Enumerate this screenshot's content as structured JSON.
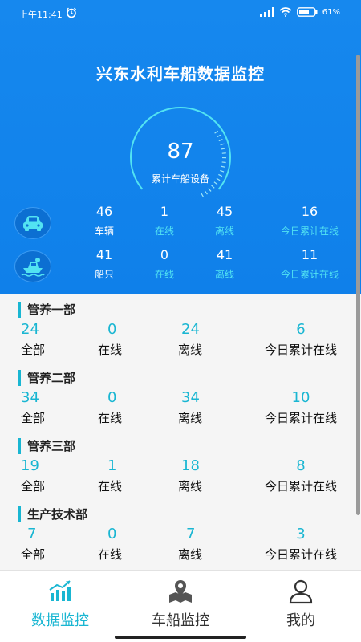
{
  "status_bar": {
    "time": "上午11:41",
    "battery": "61%"
  },
  "header": {
    "title": "兴东水利车船数据监控"
  },
  "gauge": {
    "value": "87",
    "label": "累计车船设备"
  },
  "vehicles": [
    {
      "icon": "car-icon",
      "total": "46",
      "total_label": "车辆",
      "online": "1",
      "online_label": "在线",
      "offline": "45",
      "offline_label": "离线",
      "today": "16",
      "today_label": "今日累计在线"
    },
    {
      "icon": "boat-icon",
      "total": "41",
      "total_label": "船只",
      "online": "0",
      "online_label": "在线",
      "offline": "41",
      "offline_label": "离线",
      "today": "11",
      "today_label": "今日累计在线"
    }
  ],
  "departments": [
    {
      "name": "管养一部",
      "all": "24",
      "online": "0",
      "offline": "24",
      "today": "6"
    },
    {
      "name": "管养二部",
      "all": "34",
      "online": "0",
      "offline": "34",
      "today": "10"
    },
    {
      "name": "管养三部",
      "all": "19",
      "online": "1",
      "offline": "18",
      "today": "8"
    },
    {
      "name": "生产技术部",
      "all": "7",
      "online": "0",
      "offline": "7",
      "today": "3"
    }
  ],
  "dept_labels": {
    "all": "全部",
    "online": "在线",
    "offline": "离线",
    "today": "今日累计在线"
  },
  "nav": [
    {
      "label": "数据监控",
      "icon": "chart-icon",
      "active": true
    },
    {
      "label": "车船监控",
      "icon": "map-pin-icon",
      "active": false
    },
    {
      "label": "我的",
      "icon": "user-icon",
      "active": false
    }
  ],
  "colors": {
    "header_blue": "#1688ee",
    "accent_cyan": "#19b6d2",
    "nav_active": "#19b6d2",
    "nav_inactive": "#333333"
  }
}
